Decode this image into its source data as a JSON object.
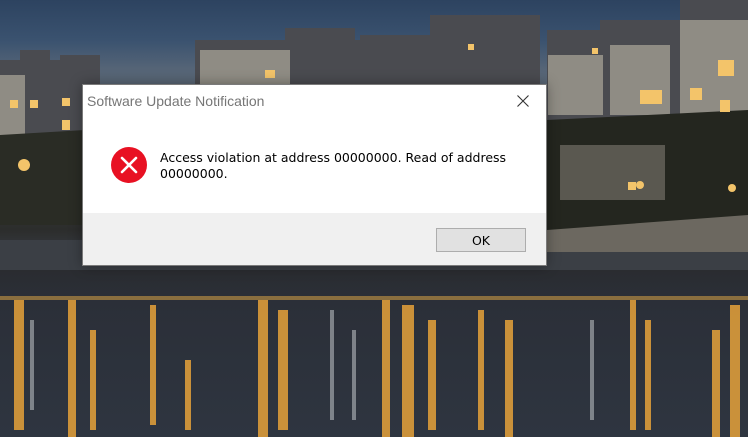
{
  "dialog": {
    "title": "Software Update Notification",
    "message": "Access violation at address 00000000. Read of address 00000000.",
    "ok_label": "OK"
  },
  "icons": {
    "error": "error-icon",
    "close": "close-icon"
  },
  "colors": {
    "error_red": "#e81123",
    "button_face": "#e1e1e1",
    "button_border": "#adadad",
    "button_area": "#f0f0f0",
    "title_text": "#767676"
  }
}
